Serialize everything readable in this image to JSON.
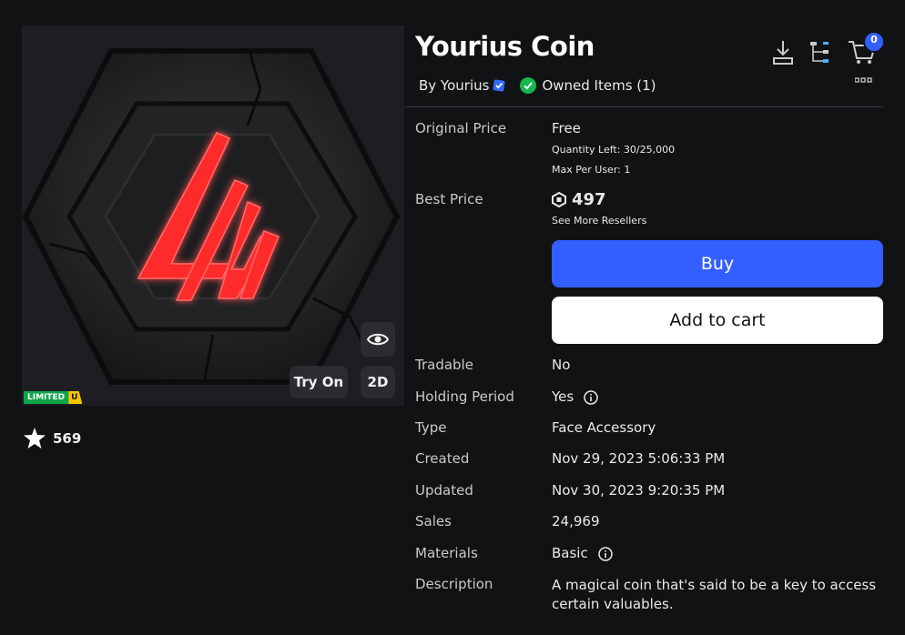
{
  "item": {
    "title": "Yourius Coin",
    "by_label": "By Yourius",
    "owned_label": "Owned Items (1)",
    "limited_label": "LIMITED",
    "limited_u": "U",
    "favorites": "569",
    "try_on": "Try On",
    "view_2d": "2D"
  },
  "cart": {
    "count": "0"
  },
  "details": {
    "original_price_label": "Original Price",
    "original_price": "Free",
    "quantity_left": "Quantity Left: 30/25,000",
    "max_per_user": "Max Per User: 1",
    "best_price_label": "Best Price",
    "best_price": "497",
    "see_more": "See More Resellers",
    "buy": "Buy",
    "add_to_cart": "Add to cart",
    "tradable_label": "Tradable",
    "tradable": "No",
    "holding_label": "Holding Period",
    "holding": "Yes",
    "type_label": "Type",
    "type": "Face Accessory",
    "created_label": "Created",
    "created": "Nov 29, 2023 5:06:33 PM",
    "updated_label": "Updated",
    "updated": "Nov 30, 2023 9:20:35 PM",
    "sales_label": "Sales",
    "sales": "24,969",
    "materials_label": "Materials",
    "materials": "Basic",
    "description_label": "Description",
    "description": "A magical coin that's said to be a key to access certain valuables."
  },
  "colors": {
    "background": "#111214",
    "buy_button": "#335fff",
    "owned_check": "#12b74f",
    "verified": "#2f6bff",
    "logo_red": "#ff2a2a",
    "limited_green": "#0fa34a",
    "limited_yellow": "#f5c400"
  },
  "icons": [
    "star-icon",
    "eye-icon",
    "verified-badge-icon",
    "check-circle-icon",
    "download-icon",
    "hierarchy-icon",
    "cart-icon",
    "more-icon",
    "robux-icon",
    "info-icon"
  ]
}
